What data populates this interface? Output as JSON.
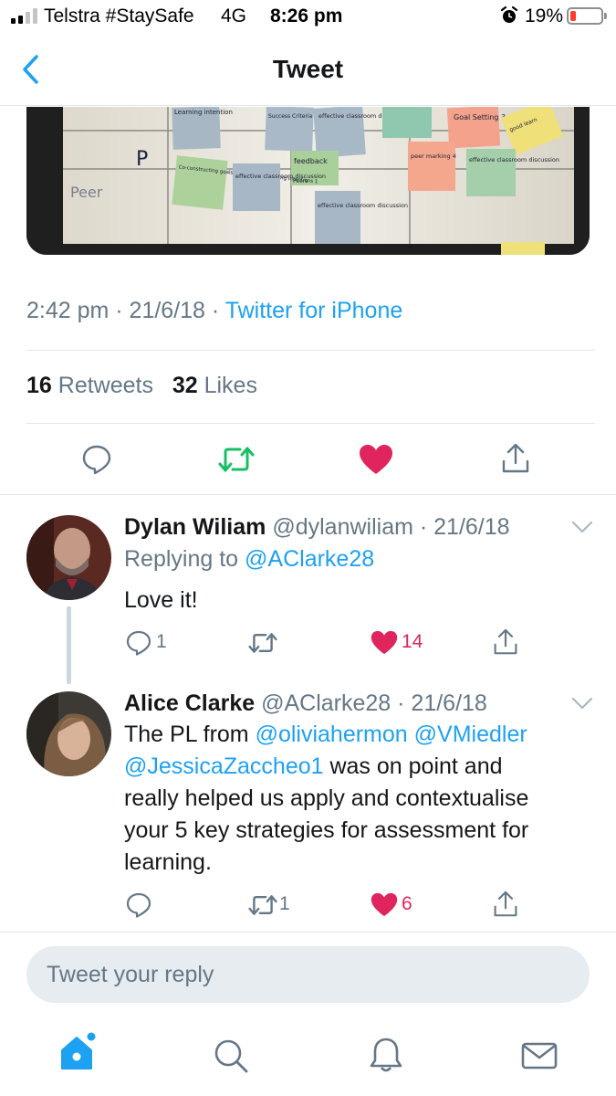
{
  "status_bar": {
    "carrier": "Telstra #StaySafe",
    "network": "4G",
    "time": "8:26 pm",
    "battery_percent": "19%",
    "icons": [
      "signal-icon",
      "alarm-icon",
      "battery-icon"
    ]
  },
  "nav": {
    "title": "Tweet",
    "back_icon": "chevron-left-icon"
  },
  "tweet": {
    "timestamp": "2:42 pm · 21/6/18 · ",
    "source": "Twitter for iPhone",
    "retweet_count": "16",
    "retweet_label": "Retweets",
    "like_count": "32",
    "like_label": "Likes",
    "media_notes": {
      "row_label": "Peer",
      "letter": "P",
      "note1": "Learning intention",
      "note2": "Success Criteria as students",
      "note3": "effective classroom discussion",
      "note4": "Goal Setting 3",
      "note5": "feedback",
      "note6": "peer marking 4",
      "note7": "effective classroom discussion",
      "note8": "Co-constructing goals, feedback discussing intentions 1",
      "note9": "effective classroom discussion",
      "note10": "effective classroom discussion",
      "note11": "Peers",
      "note12": "good learn"
    }
  },
  "replies": [
    {
      "name": "Dylan Wiliam",
      "handle": "@dylanwiliam",
      "date": "· 21/6/18",
      "replying_to_label": "Replying to ",
      "replying_to_handle": "@AClarke28",
      "text": "Love it!",
      "reply_count": "1",
      "retweet_count": "",
      "like_count": "14"
    },
    {
      "name": "Alice Clarke",
      "handle": "@AClarke28",
      "date": "· 21/6/18",
      "text_intro": "The PL from ",
      "mention1": "@oliviahermon",
      "mention2": "@VMiedler",
      "mention3": "@JessicaZaccheo1",
      "text_rest_1": " was on point and",
      "text_line_3": "really helped us apply and contextualise",
      "text_line_4": "your 5 key strategies for assessment for",
      "text_line_5": "learning.",
      "reply_count": "",
      "retweet_count": "1",
      "like_count": "6"
    }
  ],
  "reply_input": {
    "placeholder": "Tweet your reply"
  },
  "colors": {
    "accent": "#1da1f2",
    "like": "#e0245e",
    "retweet": "#17bf63",
    "secondary": "#657786"
  },
  "tab_bar": [
    "home-icon",
    "search-icon",
    "notifications-icon",
    "messages-icon"
  ]
}
